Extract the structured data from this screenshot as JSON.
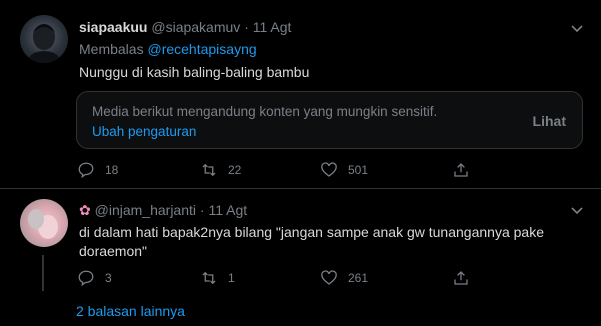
{
  "tweet1": {
    "display_name": "siapaakuu",
    "handle": "@siapakamuv",
    "separator": "·",
    "date": "11 Agt",
    "reply_prefix": "Membalas",
    "reply_to": "@recehtapisayng",
    "text": "Nunggu di kasih baling-baling bambu",
    "media_warning": "Media berikut mengandung konten yang mungkin sensitif.",
    "media_settings_link": "Ubah pengaturan",
    "media_view_button": "Lihat",
    "replies": "18",
    "retweets": "22",
    "likes": "501"
  },
  "tweet2": {
    "handle": "@injam_harjanti",
    "separator": "·",
    "date": "11 Agt",
    "text_line1": "di dalam hati bapak2nya bilang \"jangan sampe anak gw tunangannya pake",
    "text_line2": "doraemon\"",
    "replies": "3",
    "retweets": "1",
    "likes": "261"
  },
  "more_replies_link": "2 balasan lainnya",
  "colors": {
    "background": "#000000",
    "accent": "#1d9bf0",
    "muted": "#7a8087",
    "text": "#d9d9d9"
  }
}
